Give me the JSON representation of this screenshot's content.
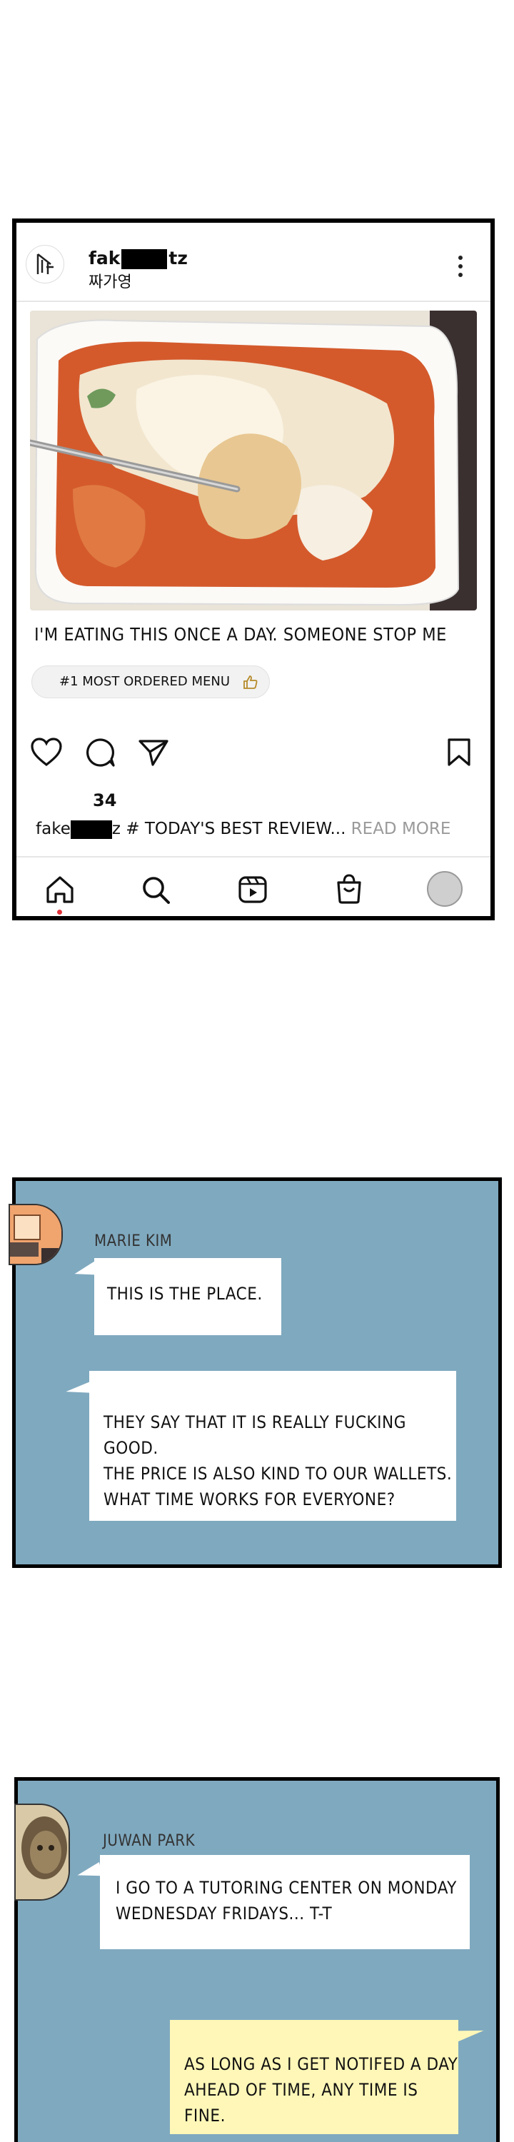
{
  "post": {
    "username_start": "fak",
    "username_end": "tz",
    "subname": "짜가영",
    "caption": "I'M EATING THIS ONCE A DAY. SOMEONE STOP ME",
    "badge": "#1 MOST ORDERED MENU",
    "likes": "34",
    "comment_user_start": "fake",
    "comment_user_end": "z",
    "comment_text": " # TODAY'S BEST REVIEW...",
    "read_more": " READ MORE"
  },
  "chat1": {
    "sender": "MARIE KIM",
    "bubble1": "THIS IS THE PLACE.",
    "bubble2_lines": [
      "THEY SAY THAT IT IS REALLY FUCKING GOOD.",
      "THE PRICE IS ALSO KIND TO OUR WALLETS.",
      "WHAT TIME WORKS FOR EVERYONE?"
    ]
  },
  "chat2": {
    "sender": "JUWAN PARK",
    "bubble1_lines": [
      "I GO TO A TUTORING CENTER ON MONDAY",
      "WEDNESDAY FRIDAYS... T-T"
    ],
    "bubble2_lines": [
      "AS LONG AS I GET NOTIFED A DAY",
      "AHEAD OF TIME, ANY TIME IS FINE."
    ]
  },
  "colors": {
    "panel_bg": "#7fa9bf",
    "reply_bubble": "#fff7b8",
    "notification_dot": "#e2323a"
  },
  "icons": [
    "logo-icon",
    "more-icon",
    "heart-icon",
    "comment-icon",
    "share-icon",
    "bookmark-icon",
    "home-icon",
    "search-icon",
    "reels-icon",
    "shop-icon",
    "profile-avatar",
    "thumbs-up-icon"
  ]
}
